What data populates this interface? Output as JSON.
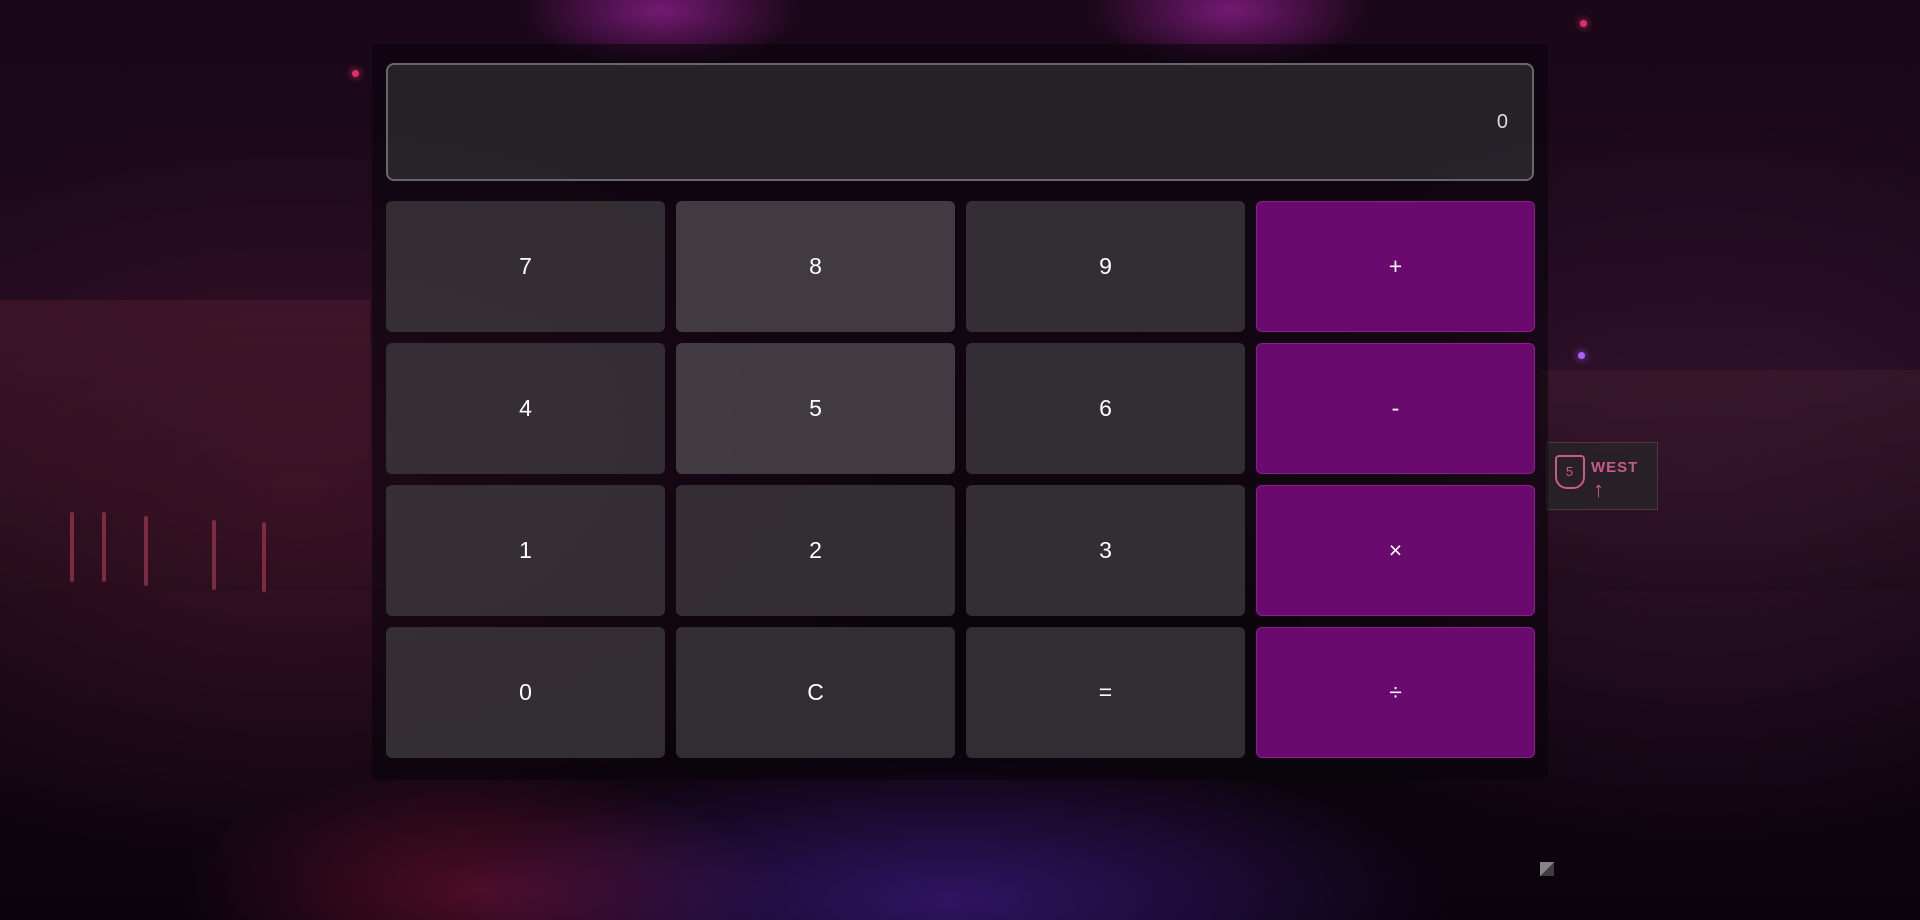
{
  "display": {
    "value": "0"
  },
  "keypad": {
    "rows": [
      [
        {
          "label": "7",
          "name": "key-7",
          "kind": "digit"
        },
        {
          "label": "8",
          "name": "key-8",
          "kind": "digit"
        },
        {
          "label": "9",
          "name": "key-9",
          "kind": "digit"
        },
        {
          "label": "+",
          "name": "add-button",
          "kind": "operator"
        }
      ],
      [
        {
          "label": "4",
          "name": "key-4",
          "kind": "digit"
        },
        {
          "label": "5",
          "name": "key-5",
          "kind": "digit"
        },
        {
          "label": "6",
          "name": "key-6",
          "kind": "digit"
        },
        {
          "label": "-",
          "name": "subtract-button",
          "kind": "operator"
        }
      ],
      [
        {
          "label": "1",
          "name": "key-1",
          "kind": "digit"
        },
        {
          "label": "2",
          "name": "key-2",
          "kind": "digit"
        },
        {
          "label": "3",
          "name": "key-3",
          "kind": "digit"
        },
        {
          "label": "×",
          "name": "multiply-button",
          "kind": "operator"
        }
      ],
      [
        {
          "label": "0",
          "name": "key-0",
          "kind": "digit"
        },
        {
          "label": "C",
          "name": "clear-button",
          "kind": "function"
        },
        {
          "label": "=",
          "name": "equals-button",
          "kind": "function"
        },
        {
          "label": "÷",
          "name": "divide-button",
          "kind": "operator"
        }
      ]
    ]
  },
  "background": {
    "sign": {
      "route": "5",
      "direction": "WEST"
    }
  },
  "colors": {
    "operator": "#6b0a6e",
    "key": "#3e3a3e",
    "display_border": "#6a656c"
  }
}
